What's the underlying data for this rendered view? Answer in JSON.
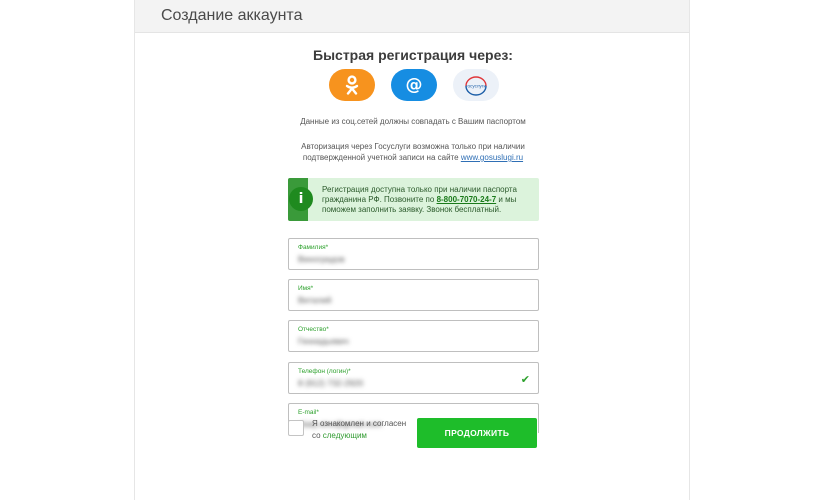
{
  "header": {
    "title": "Создание аккаунта"
  },
  "quick_signup": {
    "title": "Быстрая регистрация через:",
    "social": [
      {
        "name": "odnoklassniki",
        "icon": "odnoklassniki-icon",
        "color": "#f7931e"
      },
      {
        "name": "mail",
        "icon": "at-icon",
        "label": "@",
        "color": "#168de2"
      },
      {
        "name": "gosuslugi",
        "icon": "gosuslugi-logo",
        "label": "госуслуги",
        "color": "#ecf1f8"
      }
    ]
  },
  "notes": {
    "social_match": "Данные из соц.сетей должны совпадать с Вашим паспортом",
    "gos_line1": "Авторизация через Госуслуги возможна только при наличии",
    "gos_line2_prefix": "подтвержденной учетной записи на сайте ",
    "gos_link": "www.gosuslugi.ru"
  },
  "info": {
    "icon_label": "i",
    "line1": "Регистрация доступна только при наличии паспорта",
    "line2_prefix": "гражданина РФ. Позвоните по ",
    "phone": "8-800-7070-24-7",
    "line2_suffix": " и мы",
    "line3": "поможем заполнить заявку. Звонок бесплатный."
  },
  "form": {
    "fields": [
      {
        "label": "Фамилия*",
        "value": "Виноградов",
        "valid": false
      },
      {
        "label": "Имя*",
        "value": "Виталий",
        "valid": false
      },
      {
        "label": "Отчество*",
        "value": "Геннадьевич",
        "valid": false
      },
      {
        "label": "Телефон (логин)*",
        "value": "8 (912) 732-2920",
        "valid": true
      },
      {
        "label": "E-mail*",
        "value": "vitaly.vino@gmail.com",
        "valid": false
      }
    ],
    "agree_line1": "Я ознакомлен и согласен",
    "agree_line2_prefix": "со ",
    "agree_link": "следующим",
    "submit_label": "ПРОДОЛЖИТЬ"
  },
  "colors": {
    "accent_green": "#1ebd2a",
    "info_bg": "#dcf3dc",
    "label_green": "#2da12d"
  }
}
